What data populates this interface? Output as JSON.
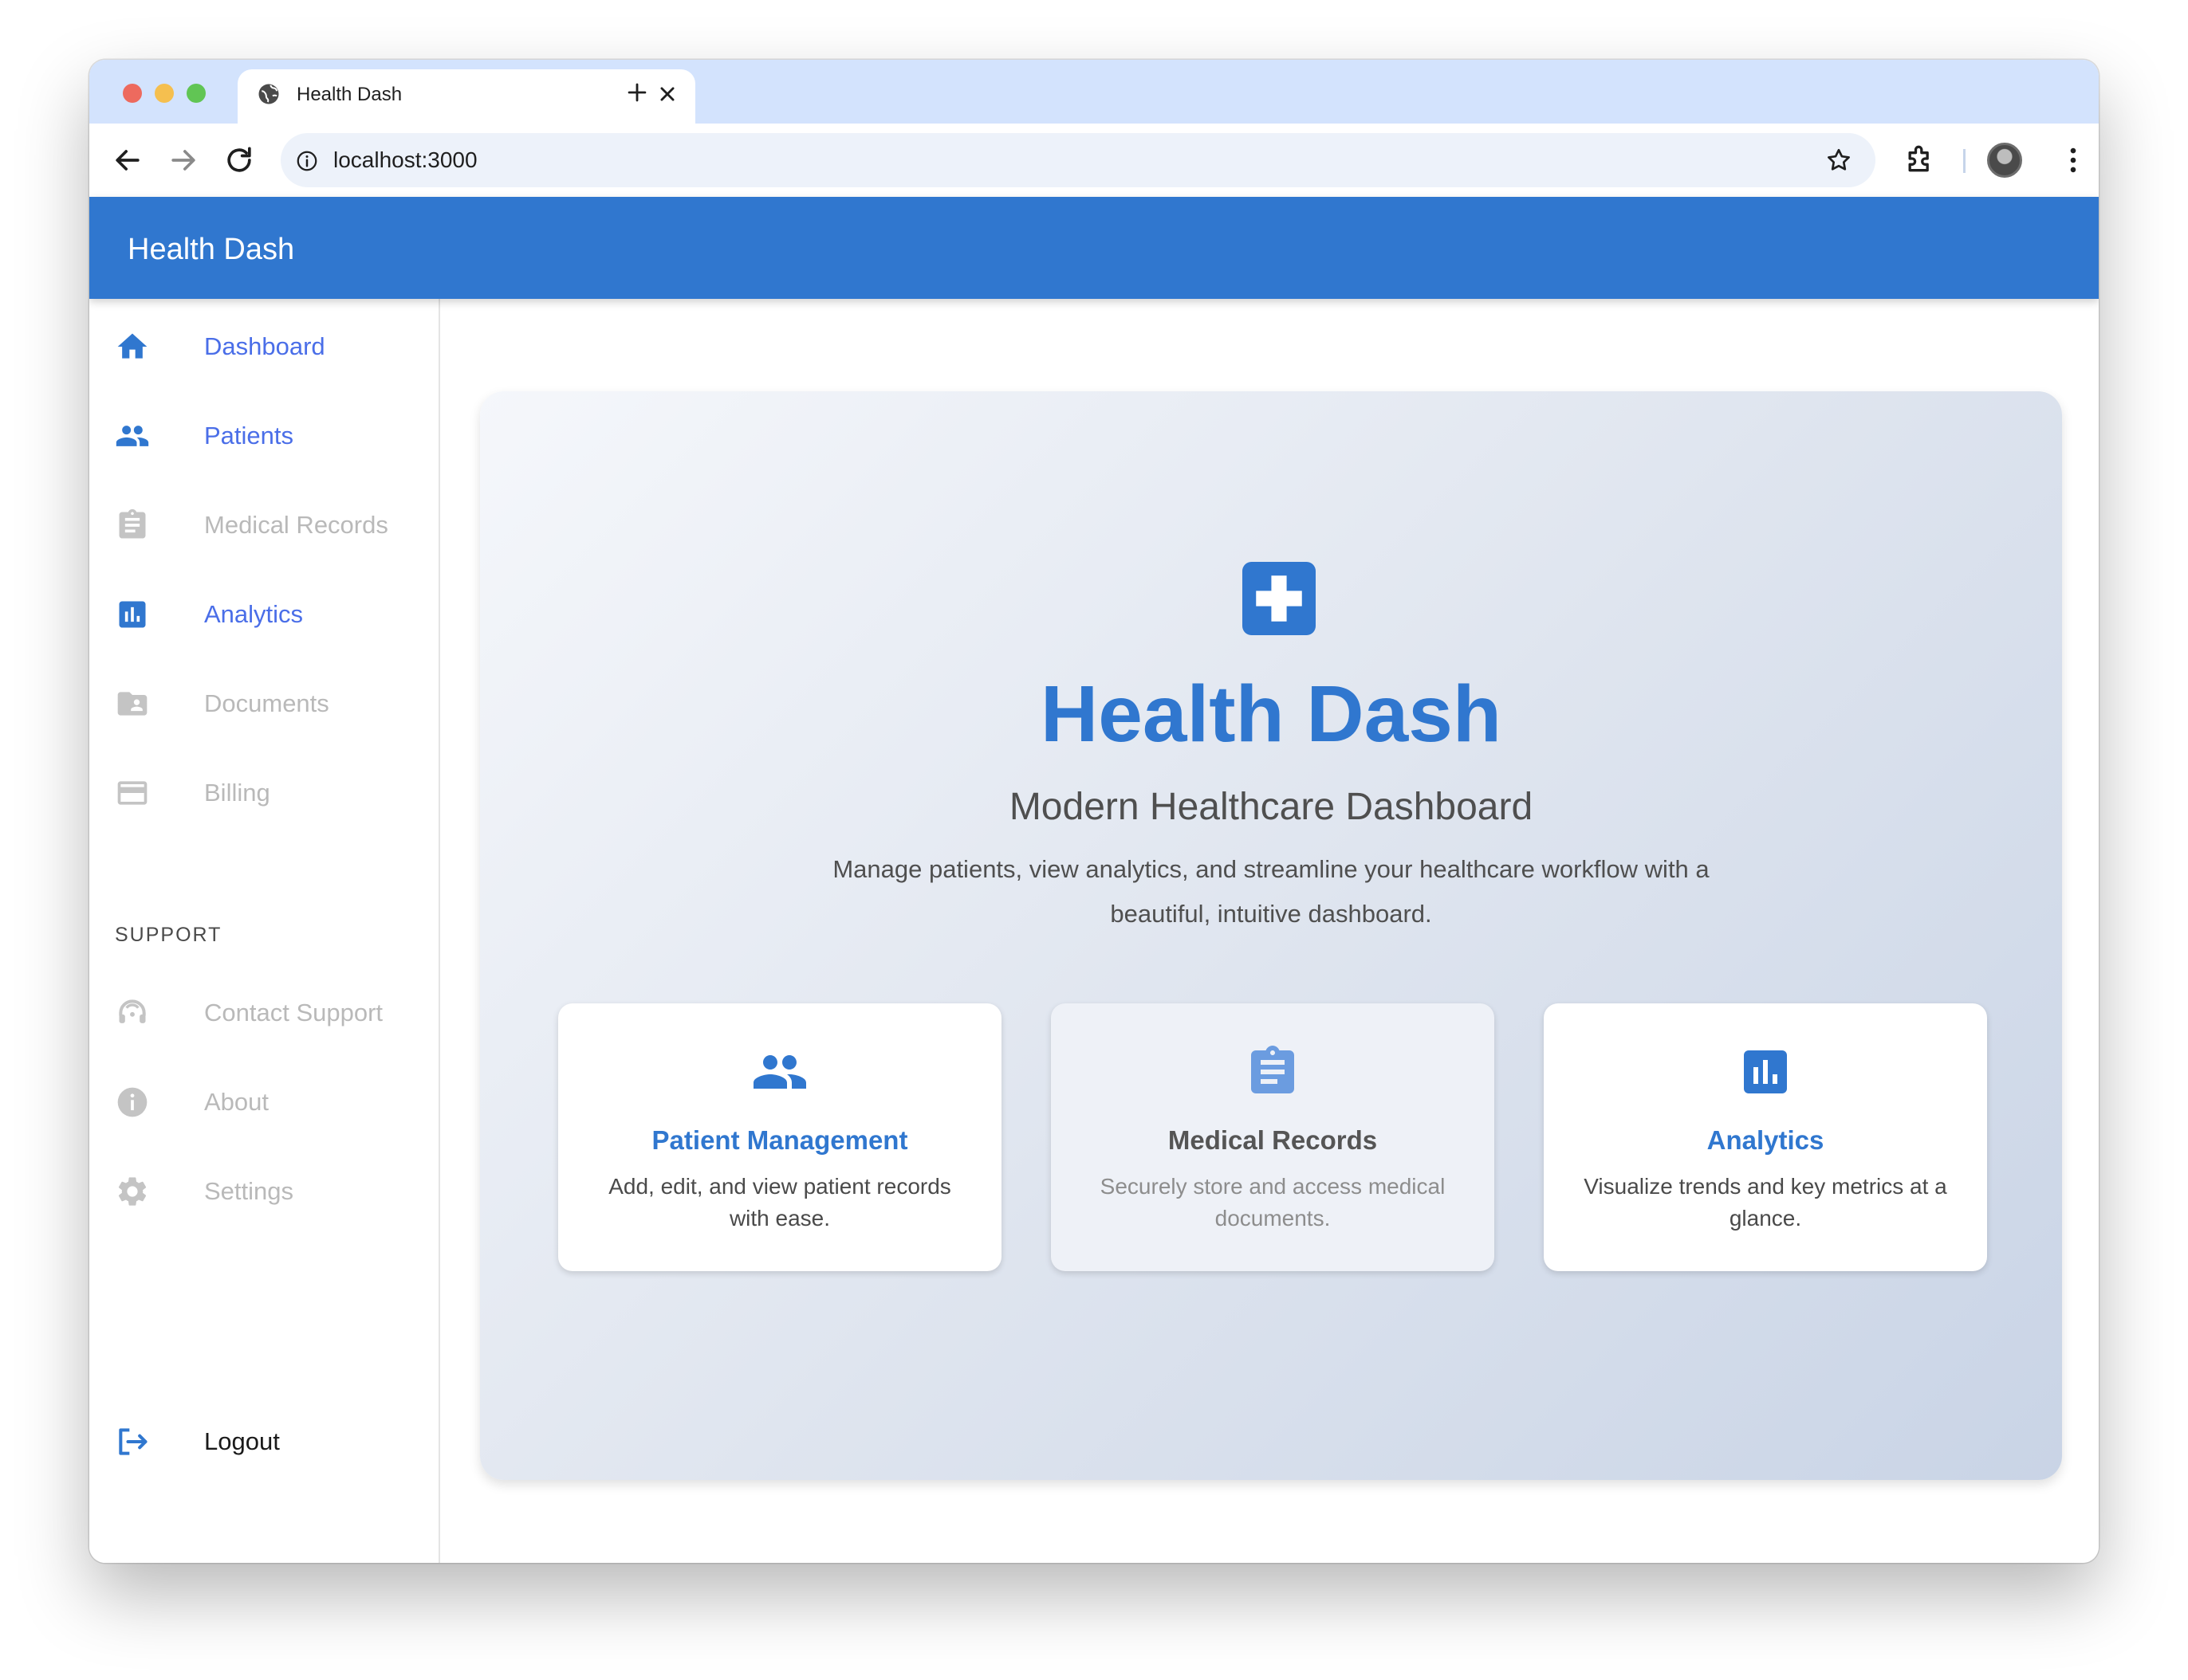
{
  "browser": {
    "tab_title": "Health Dash",
    "url": "localhost:3000"
  },
  "app": {
    "title": "Health Dash"
  },
  "sidebar": {
    "items": [
      {
        "label": "Dashboard",
        "icon": "home-icon",
        "state": "active"
      },
      {
        "label": "Patients",
        "icon": "people-icon",
        "state": "active"
      },
      {
        "label": "Medical Records",
        "icon": "clipboard-icon",
        "state": "disabled"
      },
      {
        "label": "Analytics",
        "icon": "bar-chart-icon",
        "state": "active"
      },
      {
        "label": "Documents",
        "icon": "folder-user-icon",
        "state": "disabled"
      },
      {
        "label": "Billing",
        "icon": "credit-card-icon",
        "state": "disabled"
      }
    ],
    "support_header": "SUPPORT",
    "support_items": [
      {
        "label": "Contact Support",
        "icon": "headset-icon",
        "state": "disabled"
      },
      {
        "label": "About",
        "icon": "info-icon",
        "state": "disabled"
      },
      {
        "label": "Settings",
        "icon": "gear-icon",
        "state": "disabled"
      }
    ],
    "logout_label": "Logout"
  },
  "hero": {
    "title": "Health Dash",
    "subtitle": "Modern Healthcare Dashboard",
    "description": "Manage patients, view analytics, and streamline your healthcare workflow with a beautiful, intuitive dashboard.",
    "cards": [
      {
        "title": "Patient Management",
        "description": "Add, edit, and view patient records with ease.",
        "icon": "people-icon"
      },
      {
        "title": "Medical Records",
        "description": "Securely store and access medical documents.",
        "icon": "clipboard-icon"
      },
      {
        "title": "Analytics",
        "description": "Visualize trends and key metrics at a glance.",
        "icon": "bar-chart-icon"
      }
    ]
  },
  "colors": {
    "primary": "#3077cf",
    "active_nav": "#4a6ee8",
    "disabled_nav": "#b9b9b9"
  }
}
